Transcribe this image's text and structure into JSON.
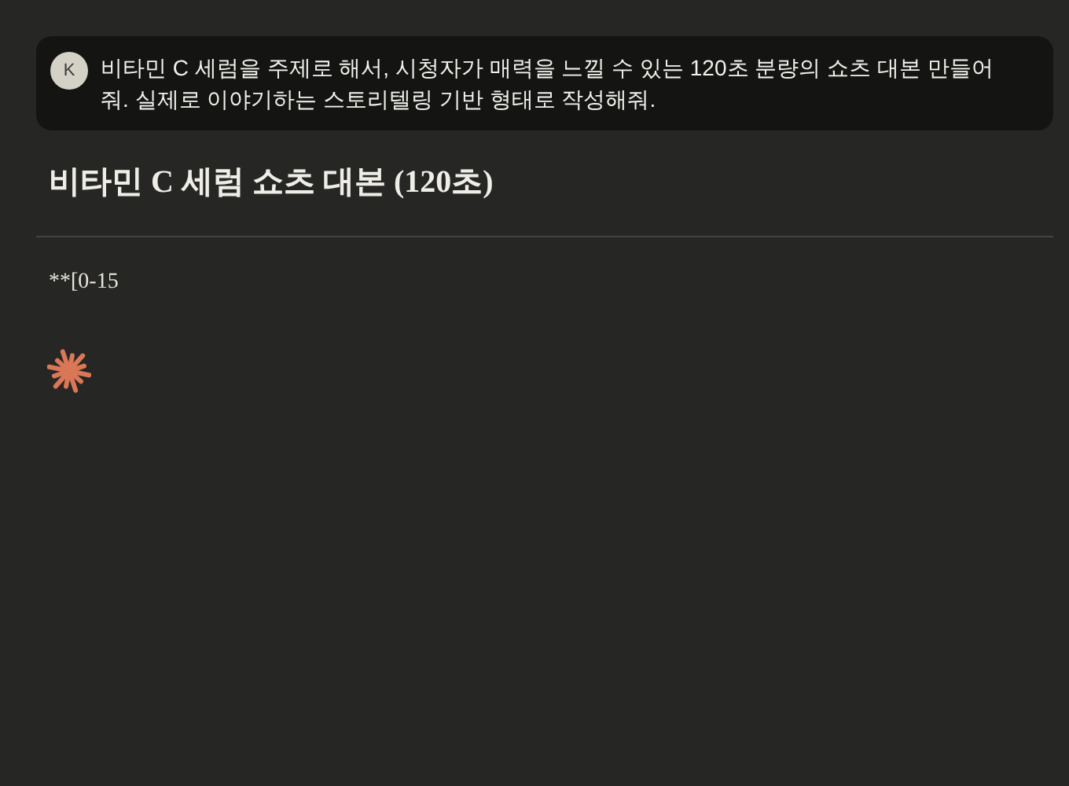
{
  "user_message": {
    "avatar": "K",
    "text": "비타민 C 세럼을 주제로 해서, 시청자가 매력을 느낄 수 있는 120초 분량의 쇼츠 대본 만들어줘. 실제로 이야기하는 스토리텔링 기반 형태로 작성해줘."
  },
  "response": {
    "heading": "비타민 C 세럼 쇼츠 대본 (120초)",
    "paragraphs": [
      "**[0-15"
    ],
    "streaming": true
  }
}
